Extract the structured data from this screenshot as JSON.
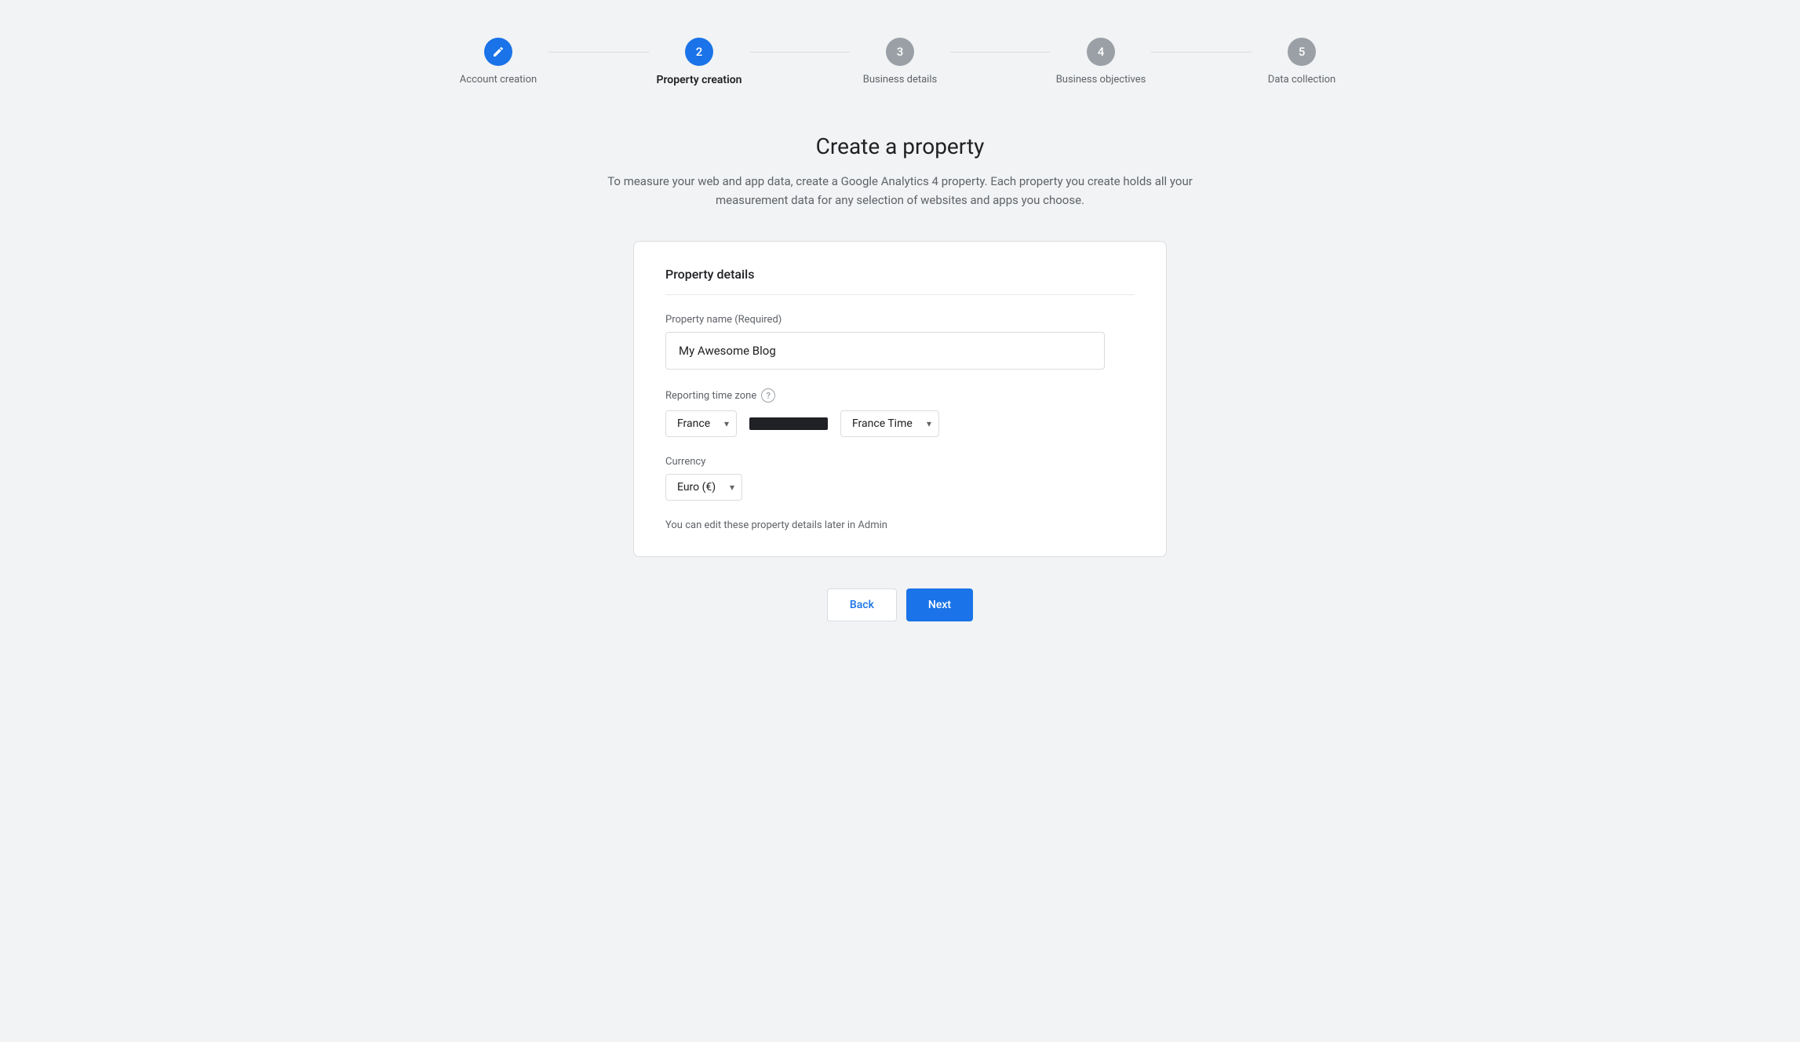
{
  "stepper": {
    "steps": [
      {
        "id": "account-creation",
        "number": "✎",
        "label": "Account creation",
        "state": "completed"
      },
      {
        "id": "property-creation",
        "number": "2",
        "label": "Property creation",
        "state": "active"
      },
      {
        "id": "business-details",
        "number": "3",
        "label": "Business details",
        "state": "inactive"
      },
      {
        "id": "business-objectives",
        "number": "4",
        "label": "Business objectives",
        "state": "inactive"
      },
      {
        "id": "data-collection",
        "number": "5",
        "label": "Data collection",
        "state": "inactive"
      }
    ]
  },
  "main": {
    "title": "Create a property",
    "description": "To measure your web and app data, create a Google Analytics 4 property. Each property you create holds all your measurement data for any selection of websites and apps you choose."
  },
  "card": {
    "title": "Property details",
    "property_name_label": "Property name (Required)",
    "property_name_value": "My Awesome Blog",
    "property_name_placeholder": "My Awesome Blog",
    "timezone_label": "Reporting time zone",
    "timezone_country": "France",
    "timezone_name": "France Time",
    "currency_label": "Currency",
    "currency_value": "Euro (€)",
    "admin_note": "You can edit these property details later in Admin"
  },
  "buttons": {
    "back_label": "Back",
    "next_label": "Next"
  },
  "icons": {
    "help": "?",
    "chevron_down": "▾",
    "pencil": "✏"
  }
}
